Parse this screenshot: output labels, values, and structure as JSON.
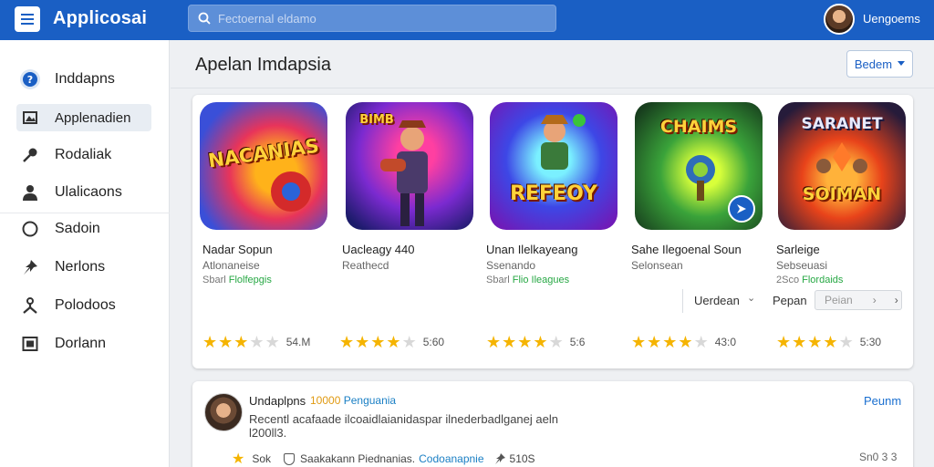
{
  "app": {
    "title": "Applicosai"
  },
  "search": {
    "placeholder": "Fectoernal eldamo"
  },
  "user": {
    "name": "Uengoems"
  },
  "sidebar": {
    "items": [
      {
        "label": "Inddapns",
        "icon": "info-icon"
      },
      {
        "label": "Applenadien",
        "icon": "image-icon"
      },
      {
        "label": "Rodaliak",
        "icon": "key-icon"
      },
      {
        "label": "Ulalicaons",
        "icon": "person-icon"
      },
      {
        "label": "Sadoin",
        "icon": "circle-icon"
      },
      {
        "label": "Nerlons",
        "icon": "pin-icon"
      },
      {
        "label": "Polodoos",
        "icon": "tag-icon"
      },
      {
        "label": "Dorlann",
        "icon": "square-icon"
      }
    ],
    "active_index": 1
  },
  "header": {
    "title": "Apelan Imdapsia",
    "sort_label": "Bedem"
  },
  "apps": [
    {
      "name": "Nadar Sopun",
      "developer": "Atlonaneise",
      "tag_num": "Sbarl",
      "tag_text": "Flolfepgis",
      "rating": 3,
      "count": "54.M",
      "tile_text": "NACANIAS",
      "colors": [
        "#ffb21a",
        "#e8345a",
        "#3a4fd8"
      ]
    },
    {
      "name": "Uacleagy 440",
      "developer": "Reathecd",
      "tag_num": "",
      "tag_text": "",
      "rating": 3,
      "count": "5:60",
      "tile_text": "BIMB",
      "colors": [
        "#ff3fa1",
        "#7b2ad0",
        "#1b1b6a"
      ]
    },
    {
      "name": "Unan Ilelkayeang",
      "developer": "Ssenando",
      "tag_num": "Sbarl",
      "tag_text": "Flio Ileagues",
      "rating": 4,
      "count": "5:6",
      "tile_text": "REFEOY",
      "colors": [
        "#7af0ff",
        "#3d47e6",
        "#6f1bb8"
      ]
    },
    {
      "name": "Sahe Ilegoenal Soun",
      "developer": "Selonsean",
      "tag_num": "",
      "tag_text": "",
      "rating": 4,
      "count": "43:0",
      "tile_text": "CHAIMS",
      "colors": [
        "#d8ff3a",
        "#3aa33a",
        "#173d1d"
      ]
    },
    {
      "name": "Sarleige",
      "developer": "Sebseuasi",
      "tag_num": "2Sco",
      "tag_text": "Flordaids",
      "rating": 4,
      "count": "5:30",
      "tile_text": "SOIMAN",
      "colors": [
        "#ffb23a",
        "#e8431a",
        "#261b3a"
      ]
    }
  ],
  "pager": {
    "label": "Uerdean",
    "next_label": "Pepan",
    "next_button": "Peian"
  },
  "review": {
    "name": "Undaplpns",
    "meta_num": "10000",
    "meta_text": "Penguania",
    "link": "Peunm",
    "text": "Recentl acafaade ilcoaidlaianidaspar ilnederbadlganej aeln l200ll3.",
    "foot_star": "Sok",
    "foot_text": "Saakakann Piednanias.",
    "foot_blue": "Codoanapnie",
    "foot_num": "510S",
    "date": "Sn0 3 3"
  },
  "colors": {
    "topbar": "#1a5fc4",
    "accent_green": "#27a844",
    "star": "#f5b400"
  }
}
